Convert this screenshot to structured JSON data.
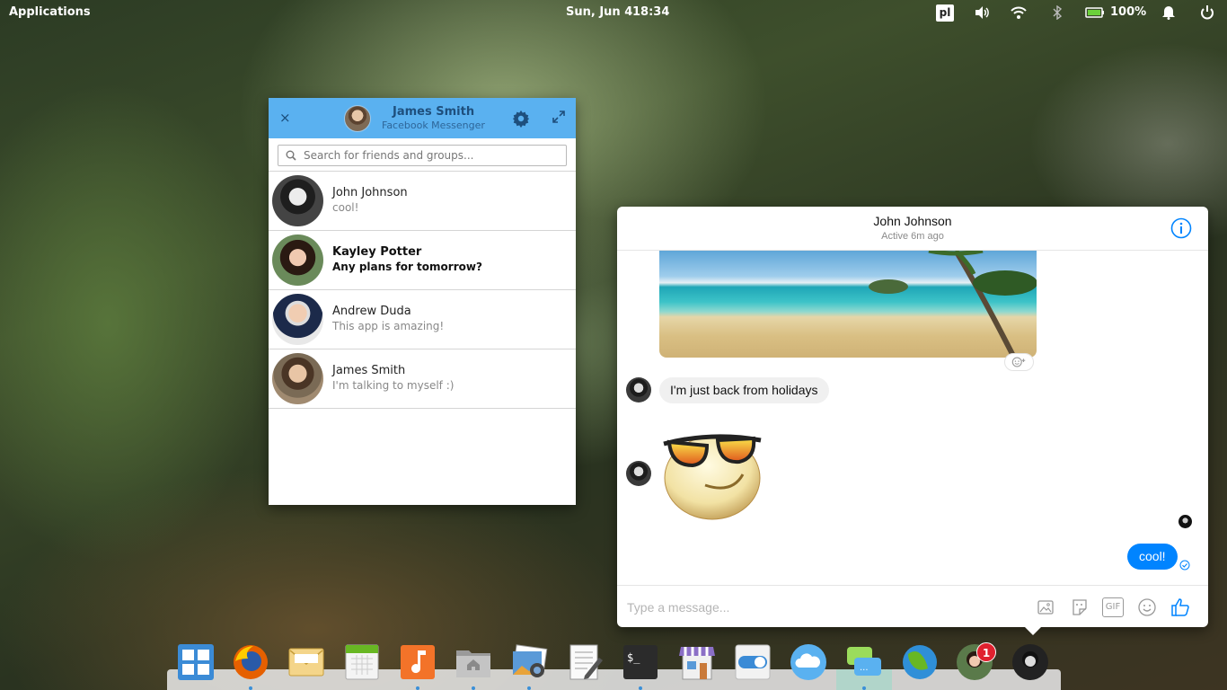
{
  "top_panel": {
    "applications": "Applications",
    "date": "Sun, Jun  4",
    "time": "18:34",
    "keyboard_layout": "pl",
    "battery": "100%"
  },
  "list_window": {
    "user_name": "James Smith",
    "app_name": "Facebook Messenger",
    "close": "×",
    "search_placeholder": "Search for friends and groups...",
    "conversations": [
      {
        "name": "John Johnson",
        "message": "cool!",
        "unread": false
      },
      {
        "name": "Kayley Potter",
        "message": "Any plans for tomorrow?",
        "unread": true
      },
      {
        "name": "Andrew Duda",
        "message": "This app is amazing!",
        "unread": false
      },
      {
        "name": "James Smith",
        "message": "I'm talking to myself :)",
        "unread": false
      }
    ]
  },
  "chat_window": {
    "title": "John Johnson",
    "status": "Active 6m ago",
    "message_in": "I'm just back from holidays",
    "message_out": "cool!",
    "composer_placeholder": "Type a message...",
    "gif_label": "GIF"
  },
  "dock": {
    "items": [
      "multitasking-view",
      "firefox",
      "mail",
      "calendar",
      "music",
      "files",
      "photos",
      "text-editor",
      "terminal",
      "app-center",
      "system-settings",
      "cloud",
      "messenger",
      "web-browser",
      "kayley-potter-chat",
      "john-johnson-chat"
    ],
    "notification_count": "1"
  },
  "colors": {
    "header_blue": "#5ab1f0",
    "message_blue": "#0084ff",
    "badge_red": "#e0212f"
  }
}
